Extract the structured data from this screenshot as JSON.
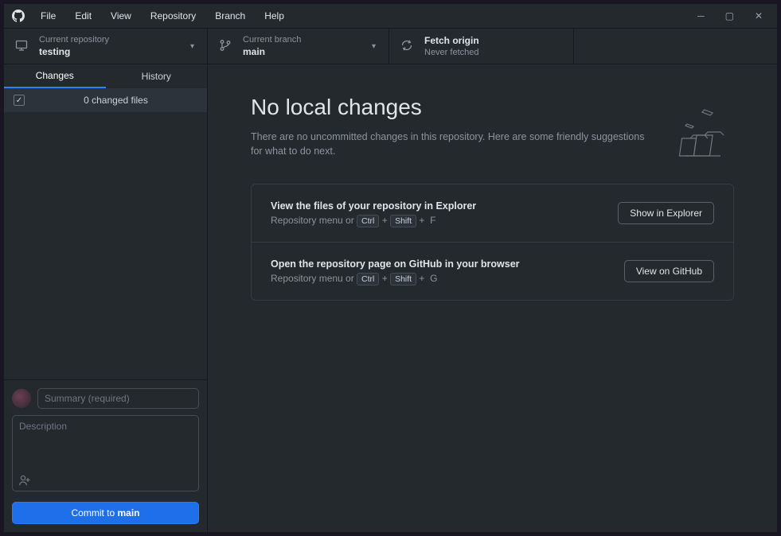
{
  "menu": {
    "items": [
      "File",
      "Edit",
      "View",
      "Repository",
      "Branch",
      "Help"
    ]
  },
  "toolbar": {
    "repo": {
      "label": "Current repository",
      "value": "testing"
    },
    "branch": {
      "label": "Current branch",
      "value": "main"
    },
    "fetch": {
      "label": "Fetch origin",
      "value": "Never fetched"
    }
  },
  "sidebar": {
    "tabs": {
      "changes": "Changes",
      "history": "History"
    },
    "files_count": "0 changed files"
  },
  "commit": {
    "summary_placeholder": "Summary (required)",
    "description_placeholder": "Description",
    "button_prefix": "Commit to ",
    "button_branch": "main"
  },
  "main": {
    "heading": "No local changes",
    "sub": "There are no uncommitted changes in this repository. Here are some friendly suggestions for what to do next."
  },
  "cards": [
    {
      "title": "View the files of your repository in Explorer",
      "hint_prefix": "Repository menu or ",
      "keys": [
        "Ctrl",
        "Shift",
        "F"
      ],
      "button": "Show in Explorer"
    },
    {
      "title": "Open the repository page on GitHub in your browser",
      "hint_prefix": "Repository menu or ",
      "keys": [
        "Ctrl",
        "Shift",
        "G"
      ],
      "button": "View on GitHub"
    }
  ]
}
